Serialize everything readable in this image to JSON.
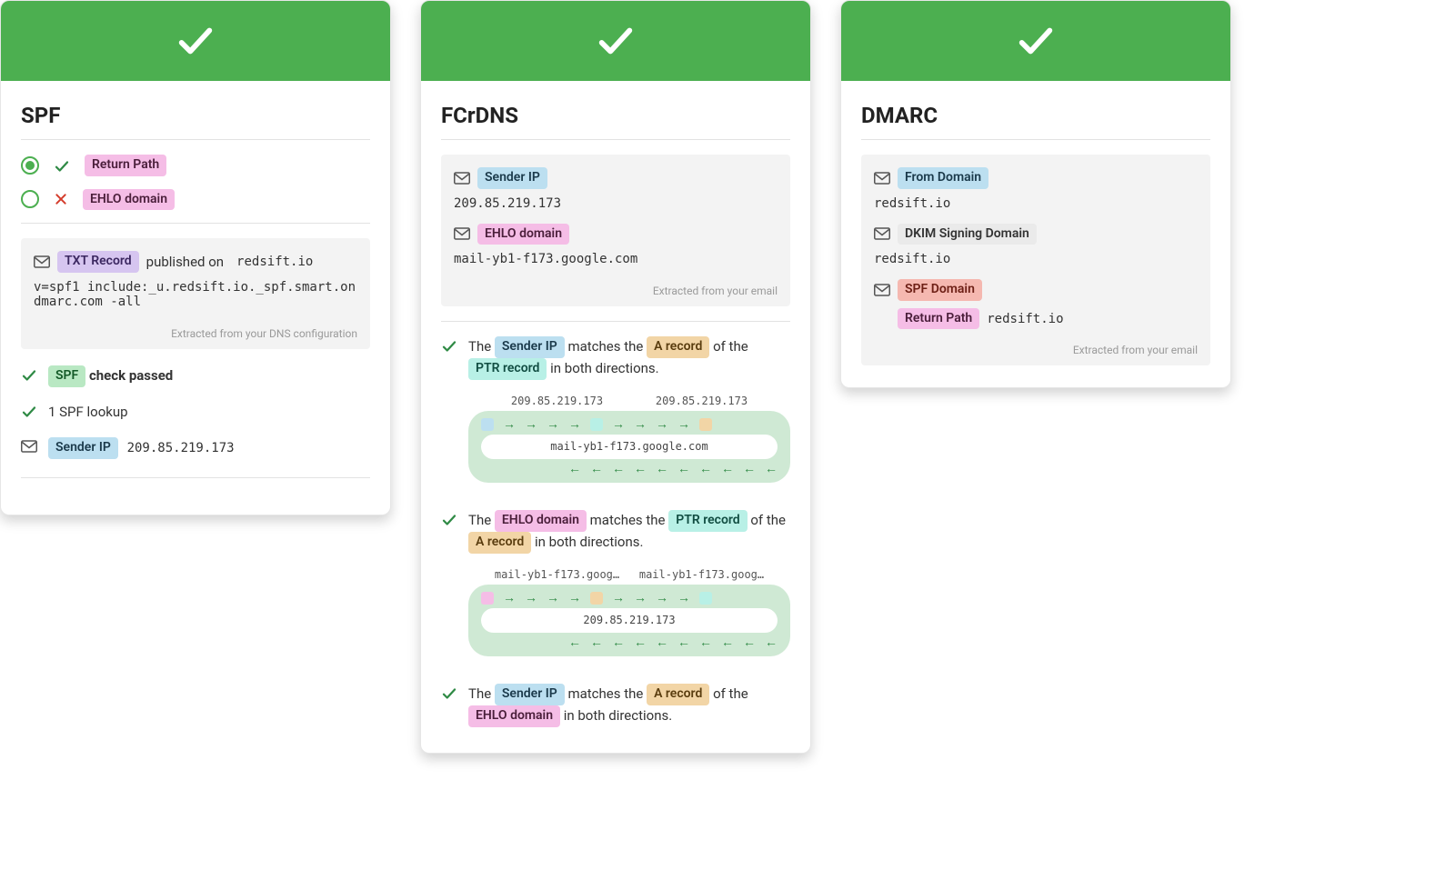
{
  "spf": {
    "title": "SPF",
    "option_return_path": "Return Path",
    "option_ehlo": "EHLO domain",
    "txt_record_label": "TXT Record",
    "published_on_text": " published on ",
    "published_on_domain": "redsift.io",
    "txt_value": "v=spf1 include:_u.redsift.io._spf.smart.ondmarc.com -all",
    "footnote": "Extracted from your DNS configuration",
    "check_tag": "SPF",
    "check_passed_text": " check passed",
    "lookup_text": "1 SPF lookup",
    "sender_ip_label": "Sender IP",
    "sender_ip_value": "209.85.219.173"
  },
  "fcr": {
    "title": "FCrDNS",
    "sender_ip_label": "Sender IP",
    "sender_ip_value": "209.85.219.173",
    "ehlo_label": "EHLO domain",
    "ehlo_value": "mail-yb1-f173.google.com",
    "footnote": "Extracted from your email",
    "res1": {
      "pre": "The ",
      "tag1": "Sender IP",
      "mid1": " matches the ",
      "tag2": "A record",
      "mid2": " of the ",
      "tag3": "PTR record",
      "post": " in both directions.",
      "lab_l": "209.85.219.173",
      "lab_r": "209.85.219.173",
      "center": "mail-yb1-f173.google.com"
    },
    "res2": {
      "pre": "The ",
      "tag1": "EHLO domain",
      "mid1": " matches the ",
      "tag2": "PTR record",
      "mid2": " of the ",
      "tag3": "A record",
      "post": " in both directions.",
      "lab_l": "mail-yb1-f173.goog…",
      "lab_r": "mail-yb1-f173.goog…",
      "center": "209.85.219.173"
    },
    "res3": {
      "pre": "The ",
      "tag1": "Sender IP",
      "mid1": " matches the ",
      "tag2": "A record",
      "mid2": " of the ",
      "tag3": "EHLO domain",
      "post": " in both directions."
    }
  },
  "dmarc": {
    "title": "DMARC",
    "from_domain_label": "From Domain",
    "from_domain_value": "redsift.io",
    "dkim_label": "DKIM Signing Domain",
    "dkim_value": "redsift.io",
    "spf_domain_label": "SPF Domain",
    "return_path_label": "Return Path",
    "return_path_value": "redsift.io",
    "footnote": "Extracted from your email"
  }
}
